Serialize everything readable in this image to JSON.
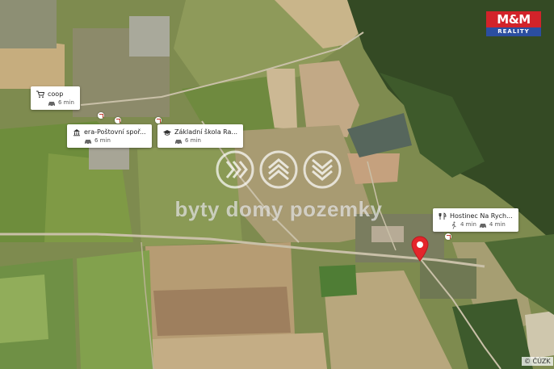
{
  "brand": {
    "logo_text": "M&M",
    "logo_sub": "REALITY",
    "red": "#d2232a",
    "blue": "#2b4ea1"
  },
  "watermark": {
    "text": "byty domy pozemky"
  },
  "pois": [
    {
      "name": "coop",
      "mode_icon": "car-icon",
      "time": "6 min",
      "category_icon": "cart-icon"
    },
    {
      "name": "era-Poštovní spoř...",
      "mode_icon": "car-icon",
      "time": "6 min",
      "category_icon": "bank-icon"
    },
    {
      "name": "Základní škola Ra...",
      "mode_icon": "car-icon",
      "time": "6 min",
      "category_icon": "school-icon"
    },
    {
      "name": "Hostinec Na Rych...",
      "walk_icon": "walk-icon",
      "walk_time": "4 min",
      "mode_icon": "car-icon",
      "time": "4 min",
      "category_icon": "restaurant-icon"
    }
  ],
  "marker": {
    "icon": "map-pin-icon",
    "color": "#e4252b"
  },
  "attribution": "© ČÚZK"
}
